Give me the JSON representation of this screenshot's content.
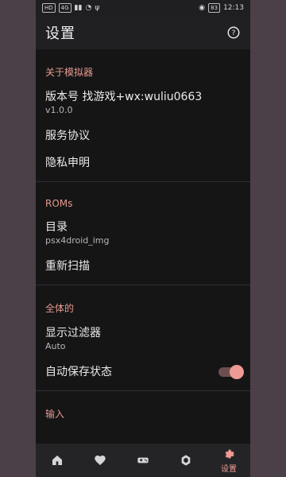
{
  "status": {
    "left_badges": [
      "HD",
      "4G"
    ],
    "battery": "83",
    "time": "12:13"
  },
  "appbar": {
    "title": "设置"
  },
  "sections": [
    {
      "header": "关于模拟器",
      "items": [
        {
          "title": "版本号  找游戏+wx:wuliu0663",
          "subtitle": "v1.0.0"
        },
        {
          "title": "服务协议"
        },
        {
          "title": "隐私申明"
        }
      ]
    },
    {
      "header": "ROMs",
      "items": [
        {
          "title": "目录",
          "subtitle": "psx4droid_img"
        },
        {
          "title": "重新扫描"
        }
      ]
    },
    {
      "header": "全体的",
      "items": [
        {
          "title": "显示过滤器",
          "subtitle": "Auto"
        },
        {
          "title": "自动保存状态",
          "toggle": true
        }
      ]
    },
    {
      "header": "输入"
    }
  ],
  "bottom_nav": [
    {
      "icon": "home-icon",
      "label": ""
    },
    {
      "icon": "heart-icon",
      "label": ""
    },
    {
      "icon": "gamepad-icon",
      "label": ""
    },
    {
      "icon": "hex-icon",
      "label": ""
    },
    {
      "icon": "gear-icon",
      "label": "设置"
    }
  ],
  "colors": {
    "accent": "#ef9a93",
    "background": "#151516"
  }
}
